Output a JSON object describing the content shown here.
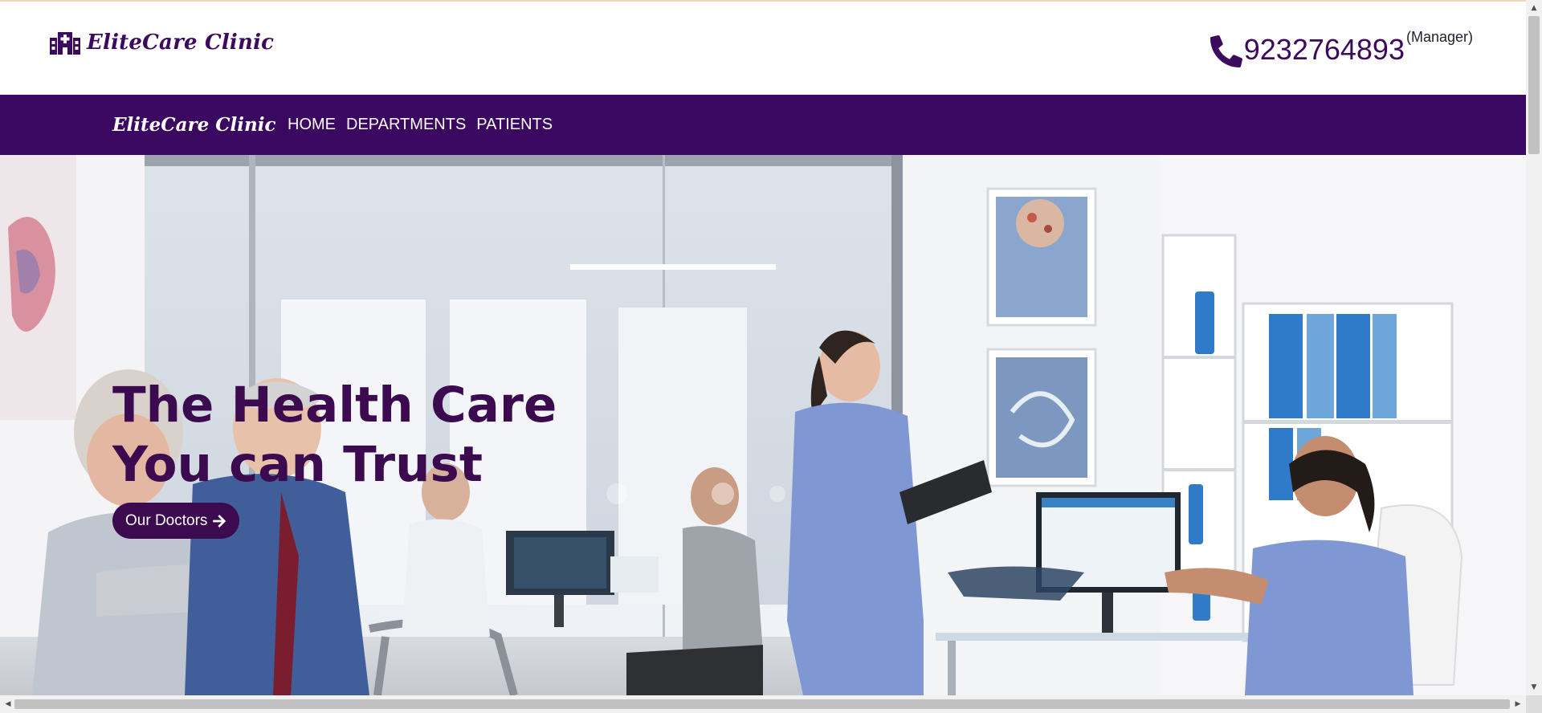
{
  "header": {
    "brand": "EliteCare Clinic",
    "brand_icon": "hospital-icon",
    "phone_icon": "phone-icon",
    "phone_number": "9232764893",
    "phone_role": "(Manager)"
  },
  "nav": {
    "brand": "EliteCare Clinic",
    "links": [
      "HOME",
      "DEPARTMENTS",
      "PATIENTS"
    ]
  },
  "hero": {
    "title": "The Health Care You can Trust",
    "button_label": "Our Doctors",
    "button_icon": "arrow-right-icon",
    "image_subject": "medical staff in clinic reception"
  },
  "colors": {
    "brand_purple": "#3a0761",
    "title_purple": "#3b0a4f",
    "nav_text": "#ffffff"
  }
}
